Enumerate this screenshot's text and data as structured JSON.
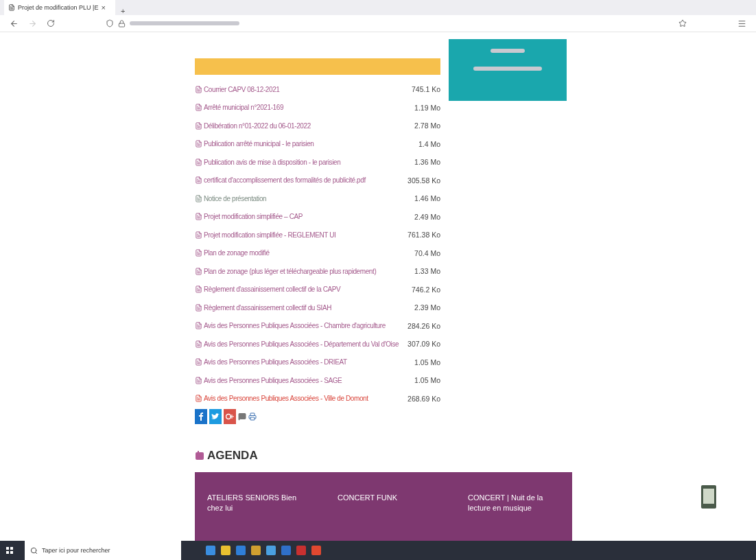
{
  "browser": {
    "tab_title": "Projet de modification PLU |E",
    "close": "×",
    "new_tab": "+"
  },
  "files": [
    {
      "name": "Courrier CAPV 08-12-2021",
      "size": "745.1 Ko",
      "color": "#a45a8c"
    },
    {
      "name": "Arrêté municipal n°2021-169",
      "size": "1.19 Mo",
      "color": "#a45a8c"
    },
    {
      "name": "Délibération n°01-2022 du 06-01-2022",
      "size": "2.78 Mo",
      "color": "#a45a8c"
    },
    {
      "name": "Publication arrêté municipal - le parisien",
      "size": "1.4 Mo",
      "color": "#a45a8c"
    },
    {
      "name": "Publication avis de mise à disposition - le parisien",
      "size": "1.36 Mo",
      "color": "#a45a8c"
    },
    {
      "name": "certificat d'accomplissement des formalités de publicité.pdf",
      "size": "305.58 Ko",
      "color": "#a45a8c"
    },
    {
      "name": "Notice de présentation",
      "size": "1.46 Mo",
      "color": "#7a8a80"
    },
    {
      "name": "Projet modification simplifiée – CAP",
      "size": "2.49 Mo",
      "color": "#a45a8c"
    },
    {
      "name": "Projet modification simplifiée - REGLEMENT UI",
      "size": "761.38 Ko",
      "color": "#a45a8c"
    },
    {
      "name": "Plan de zonage modifié",
      "size": "70.4 Mo",
      "color": "#a45a8c"
    },
    {
      "name": "Plan de zonage (plus léger et téléchargeable plus rapidement)",
      "size": "1.33 Mo",
      "color": "#a45a8c"
    },
    {
      "name": "Règlement d'assainissement collectif de la CAPV",
      "size": "746.2 Ko",
      "color": "#a45a8c"
    },
    {
      "name": "Règlement d'assainissement collectif du SIAH",
      "size": "2.39 Mo",
      "color": "#a45a8c"
    },
    {
      "name": "Avis des Personnes Publiques Associées - Chambre d'agriculture",
      "size": "284.26 Ko",
      "color": "#a45a8c"
    },
    {
      "name": "Avis des Personnes Publiques Associées - Département du Val d'Oise",
      "size": "307.09 Ko",
      "color": "#a45a8c"
    },
    {
      "name": "Avis des Personnes Publiques Associées - DRIEAT",
      "size": "1.05 Mo",
      "color": "#a45a8c"
    },
    {
      "name": "Avis des Personnes Publiques Associées - SAGE",
      "size": "1.05 Mo",
      "color": "#a45a8c"
    },
    {
      "name": "Avis des Personnes Publiques Associées - Ville de Domont",
      "size": "268.69 Ko",
      "color": "#d9453b"
    }
  ],
  "agenda": {
    "title": "AGENDA",
    "events": [
      {
        "title": "ATELIERS SENIORS Bien chez lui"
      },
      {
        "title": "CONCERT FUNK"
      },
      {
        "title": "CONCERT | Nuit de la lecture en musique"
      }
    ]
  },
  "taskbar": {
    "search_placeholder": "Taper ici pour rechercher"
  }
}
